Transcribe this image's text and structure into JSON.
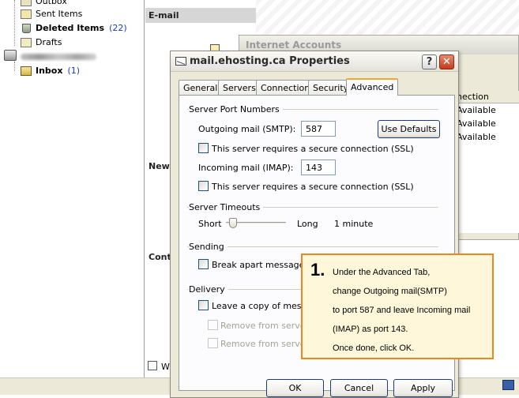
{
  "folders": [
    {
      "label": "Outbox",
      "count": "",
      "bold": false
    },
    {
      "label": "Sent Items",
      "count": "",
      "bold": false
    },
    {
      "label": "Deleted Items",
      "count": "(22)",
      "bold": true
    },
    {
      "label": "Drafts",
      "count": "",
      "bold": false
    },
    {
      "label": "Inbox",
      "count": "(1)",
      "bold": true
    }
  ],
  "right_pane": {
    "email_header": "E-mail",
    "new_header": "New",
    "cont_header": "Cont",
    "bottom_check_label": "W"
  },
  "internet_accounts": {
    "title": "Internet Accounts",
    "column_header": "nection",
    "rows": [
      "Available",
      "Available",
      "Available"
    ]
  },
  "dialog": {
    "title": "mail.ehosting.ca Properties",
    "help_label": "?",
    "close_label": "✕",
    "tabs": [
      "General",
      "Servers",
      "Connection",
      "Security",
      "Advanced"
    ],
    "active_tab": "Advanced",
    "server_ports": {
      "group_label": "Server Port Numbers",
      "outgoing_label": "Outgoing mail (SMTP):",
      "outgoing_value": "587",
      "use_defaults_label": "Use Defaults",
      "ssl_outgoing_label": "This server requires a secure connection (SSL)",
      "incoming_label": "Incoming mail (IMAP):",
      "incoming_value": "143",
      "ssl_incoming_label": "This server requires a secure connection (SSL)"
    },
    "timeouts": {
      "group_label": "Server Timeouts",
      "short_label": "Short",
      "long_label": "Long",
      "value_label": "1 minute"
    },
    "sending": {
      "group_label": "Sending",
      "break_apart_label": "Break apart messages la"
    },
    "delivery": {
      "group_label": "Delivery",
      "leave_copy_label": "Leave a copy of messag",
      "remove_after_label": "Remove from server a",
      "remove_deleted_label": "Remove from server w"
    },
    "buttons": {
      "ok": "OK",
      "cancel": "Cancel",
      "apply": "Apply"
    }
  },
  "callout": {
    "number": "1.",
    "lines": [
      "Under the Advanced Tab,",
      "change Outgoing mail(SMTP)",
      "to port 587 and leave Incoming mail",
      "(IMAP) as port 143.",
      "Once done, click OK."
    ]
  },
  "colors": {
    "callout_border": "#f0841e",
    "callout_fill": "#fff7d9",
    "active_tab_accent": "#f0a73a",
    "close_button": "#c23b1b",
    "count_blue": "#1a3fb0"
  }
}
